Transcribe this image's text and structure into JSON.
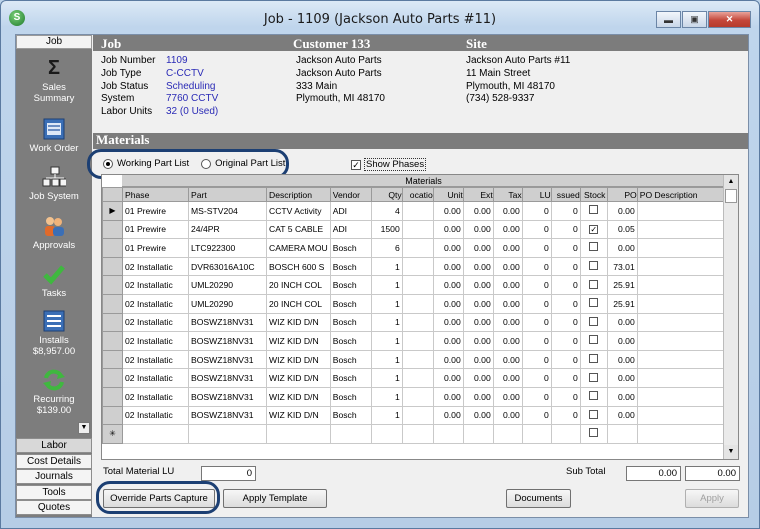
{
  "window": {
    "title": "Job - 1109 (Jackson Auto Parts #11)",
    "app_icon": "S",
    "min": "▬",
    "max": "▣",
    "close": "✕"
  },
  "sidebar": {
    "header": "Job",
    "items": [
      {
        "label": "Sales\nSummary",
        "icon": "sigma-icon"
      },
      {
        "label": "Work Order",
        "icon": "form-icon"
      },
      {
        "label": "Job System",
        "icon": "network-icon"
      },
      {
        "label": "Approvals",
        "icon": "people-icon"
      },
      {
        "label": "Tasks",
        "icon": "check-icon"
      },
      {
        "label": "Installs\n$8,957.00",
        "icon": "list-icon"
      },
      {
        "label": "Recurring\n$139.00",
        "icon": "recycle-icon"
      }
    ],
    "tabs": [
      "Labor",
      "Cost Details",
      "Journals",
      "Tools",
      "Quotes"
    ]
  },
  "header": {
    "job": "Job",
    "customer": "Customer 133",
    "site": "Site"
  },
  "job": {
    "labels": [
      "Job Number",
      "Job Type",
      "Job Status",
      "System",
      "Labor Units"
    ],
    "values": [
      "1109",
      "C-CCTV",
      "Scheduling",
      "7760 CCTV",
      "32 (0 Used)"
    ]
  },
  "customer": {
    "lines": [
      "Jackson Auto Parts",
      "Jackson Auto Parts",
      "333 Main",
      "Plymouth, MI  48170"
    ]
  },
  "site": {
    "lines": [
      "Jackson Auto Parts #11",
      "11 Main Street",
      "Plymouth, MI  48170",
      "(734) 528-9337"
    ]
  },
  "materials": {
    "section_title": "Materials",
    "working_label": "Working Part List",
    "original_label": "Original Part List",
    "show_phases_label": "Show Phases",
    "grid_caption": "Materials",
    "columns": [
      "Phase",
      "Part",
      "Description",
      "Vendor",
      "Qty",
      "ocatio",
      "Unit",
      "Ext",
      "Tax",
      "LU",
      "ssued",
      "Stock",
      "PO",
      "PO Description"
    ],
    "rows": [
      [
        "01 Prewire",
        "MS-STV204",
        "CCTV Activity",
        "ADI",
        "4",
        "",
        "0.00",
        "0.00",
        "0.00",
        "0",
        "0",
        "",
        "0.00",
        ""
      ],
      [
        "01 Prewire",
        "24/4PR",
        "CAT 5 CABLE",
        "ADI",
        "1500",
        "",
        "0.00",
        "0.00",
        "0.00",
        "0",
        "0",
        "✓",
        "0.05",
        ""
      ],
      [
        "01 Prewire",
        "LTC922300",
        "CAMERA MOU",
        "Bosch",
        "6",
        "",
        "0.00",
        "0.00",
        "0.00",
        "0",
        "0",
        "",
        "0.00",
        ""
      ],
      [
        "02 Installatic",
        "DVR63016A10C",
        "BOSCH 600 S",
        "Bosch",
        "1",
        "",
        "0.00",
        "0.00",
        "0.00",
        "0",
        "0",
        "",
        "73.01",
        ""
      ],
      [
        "02 Installatic",
        "UML20290",
        "20 INCH  COL",
        "Bosch",
        "1",
        "",
        "0.00",
        "0.00",
        "0.00",
        "0",
        "0",
        "",
        "25.91",
        ""
      ],
      [
        "02 Installatic",
        "UML20290",
        "20 INCH  COL",
        "Bosch",
        "1",
        "",
        "0.00",
        "0.00",
        "0.00",
        "0",
        "0",
        "",
        "25.91",
        ""
      ],
      [
        "02 Installatic",
        "BOSWZ18NV31",
        "WIZ KID D/N",
        "Bosch",
        "1",
        "",
        "0.00",
        "0.00",
        "0.00",
        "0",
        "0",
        "",
        "0.00",
        ""
      ],
      [
        "02 Installatic",
        "BOSWZ18NV31",
        "WIZ KID D/N",
        "Bosch",
        "1",
        "",
        "0.00",
        "0.00",
        "0.00",
        "0",
        "0",
        "",
        "0.00",
        ""
      ],
      [
        "02 Installatic",
        "BOSWZ18NV31",
        "WIZ KID D/N",
        "Bosch",
        "1",
        "",
        "0.00",
        "0.00",
        "0.00",
        "0",
        "0",
        "",
        "0.00",
        ""
      ],
      [
        "02 Installatic",
        "BOSWZ18NV31",
        "WIZ KID D/N",
        "Bosch",
        "1",
        "",
        "0.00",
        "0.00",
        "0.00",
        "0",
        "0",
        "",
        "0.00",
        ""
      ],
      [
        "02 Installatic",
        "BOSWZ18NV31",
        "WIZ KID D/N",
        "Bosch",
        "1",
        "",
        "0.00",
        "0.00",
        "0.00",
        "0",
        "0",
        "",
        "0.00",
        ""
      ],
      [
        "02 Installatic",
        "BOSWZ18NV31",
        "WIZ KID D/N",
        "Bosch",
        "1",
        "",
        "0.00",
        "0.00",
        "0.00",
        "0",
        "0",
        "",
        "0.00",
        ""
      ]
    ],
    "new_row_marker": "✳",
    "current_row_marker": "▶"
  },
  "footer": {
    "total_lu_label": "Total Material LU",
    "total_lu_value": "0",
    "subtotal_label": "Sub Total",
    "subtotal_1": "0.00",
    "subtotal_2": "0.00",
    "override_button": "Override Parts Capture",
    "apply_template_button": "Apply Template",
    "documents_button": "Documents",
    "apply_button": "Apply"
  },
  "colors": {
    "accent_oval": "#1c3f73",
    "header_gray": "#7c7c7c",
    "link_blue": "#2b2bb6"
  }
}
